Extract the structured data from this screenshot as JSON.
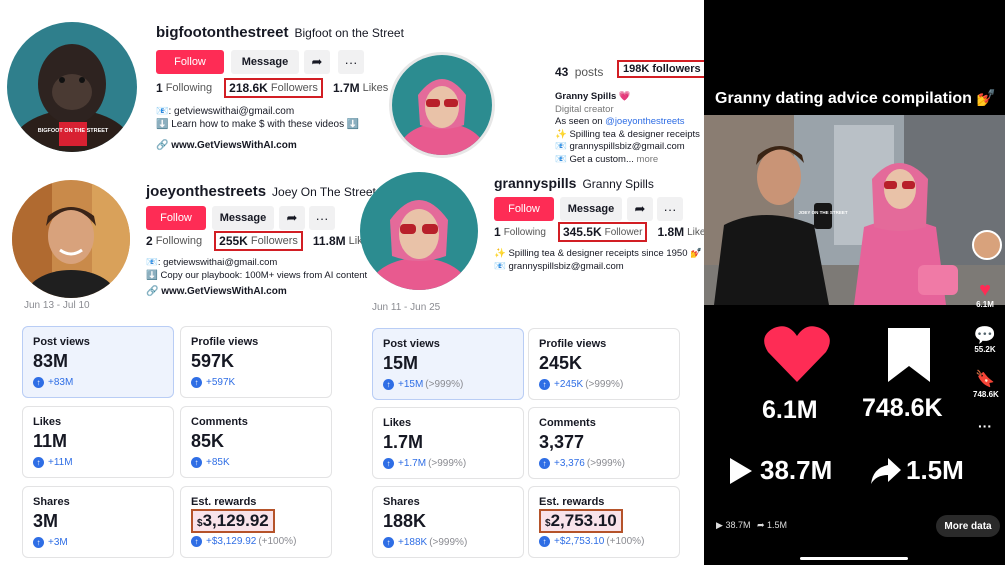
{
  "profiles": {
    "bigfoot": {
      "username": "bigfootonthestreet",
      "display_name": "Bigfoot on the Street",
      "follow_label": "Follow",
      "message_label": "Message",
      "following_count": "1",
      "following_label": "Following",
      "followers_count": "218.6K",
      "followers_label": "Followers",
      "likes_count": "1.7M",
      "likes_label": "Likes",
      "bio_email": "📧: getviewswithai@gmail.com",
      "bio_line2": "⬇️ Learn how to make $ with these videos ⬇️",
      "link": "🔗 www.GetViewsWithAI.com",
      "mic_text": "BIGFOOT ON THE STREET"
    },
    "granny_top": {
      "posts_count": "43",
      "posts_label": "posts",
      "followers_text": "198K followers",
      "name": "Granny Spills 💗",
      "category": "Digital creator",
      "as_seen_prefix": "As seen on ",
      "as_seen_handle": "@joeyonthestreets",
      "line1": "✨ Spilling tea & designer receipts",
      "line2": "📧 grannyspillsbiz@gmail.com",
      "line3": "📧 Get a custom... ",
      "more": "more"
    },
    "joey": {
      "username": "joeyonthestreets",
      "display_name": "Joey On The Street",
      "follow_label": "Follow",
      "message_label": "Message",
      "following_count": "2",
      "following_label": "Following",
      "followers_count": "255K",
      "followers_label": "Followers",
      "likes_count": "11.8M",
      "likes_label": "Likes",
      "bio_email": "📧: getviewswithai@gmail.com",
      "bio_line2": "⬇️ Copy our playbook: 100M+ views from AI content",
      "link": "🔗 www.GetViewsWithAI.com"
    },
    "granny": {
      "username": "grannyspills",
      "display_name": "Granny Spills",
      "follow_label": "Follow",
      "message_label": "Message",
      "following_count": "1",
      "following_label": "Following",
      "followers_count": "345.5K",
      "followers_label": "Follower",
      "likes_count": "1.8M",
      "likes_label": "Likes",
      "bio_line1": "✨ Spilling tea & designer receipts since 1950 💅",
      "bio_email": "📧 grannyspillsbiz@gmail.com"
    }
  },
  "analytics": {
    "left": {
      "date_range": "Jun 13 - Jul 10",
      "cards": [
        {
          "title": "Post views",
          "value": "83M",
          "delta": "+83M",
          "pct": ""
        },
        {
          "title": "Profile views",
          "value": "597K",
          "delta": "+597K",
          "pct": ""
        },
        {
          "title": "Likes",
          "value": "11M",
          "delta": "+11M",
          "pct": ""
        },
        {
          "title": "Comments",
          "value": "85K",
          "delta": "+85K",
          "pct": ""
        },
        {
          "title": "Shares",
          "value": "3M",
          "delta": "+3M",
          "pct": ""
        },
        {
          "title": "Est. rewards",
          "value_prefix": "$",
          "value": "3,129.92",
          "delta": "+$3,129.92",
          "pct": "(+100%)"
        }
      ]
    },
    "right": {
      "date_range": "Jun 11 - Jun 25",
      "cards": [
        {
          "title": "Post views",
          "value": "15M",
          "delta": "+15M",
          "pct": "(>999%)"
        },
        {
          "title": "Profile views",
          "value": "245K",
          "delta": "+245K",
          "pct": "(>999%)"
        },
        {
          "title": "Likes",
          "value": "1.7M",
          "delta": "+1.7M",
          "pct": "(>999%)"
        },
        {
          "title": "Comments",
          "value": "3,377",
          "delta": "+3,376",
          "pct": "(>999%)"
        },
        {
          "title": "Shares",
          "value": "188K",
          "delta": "+188K",
          "pct": "(>999%)"
        },
        {
          "title": "Est. rewards",
          "value_prefix": "$",
          "value": "2,753.10",
          "delta": "+$2,753.10",
          "pct": "(+100%)"
        }
      ]
    }
  },
  "phone": {
    "title": "Granny dating advice compilation 💅",
    "mic_text": "JOEY ON THE STREET",
    "side_likes": "6.1M",
    "side_comments": "55.2K",
    "side_saves": "748.6K",
    "big_likes": "6.1M",
    "big_saves": "748.6K",
    "big_plays": "38.7M",
    "big_shares": "1.5M",
    "small_plays": "38.7M",
    "small_shares": "1.5M",
    "more_data_label": "More data"
  },
  "colors": {
    "follow": "#fe2c55",
    "highlight_box": "#d21e24",
    "delta_blue": "#2f6ee5"
  }
}
